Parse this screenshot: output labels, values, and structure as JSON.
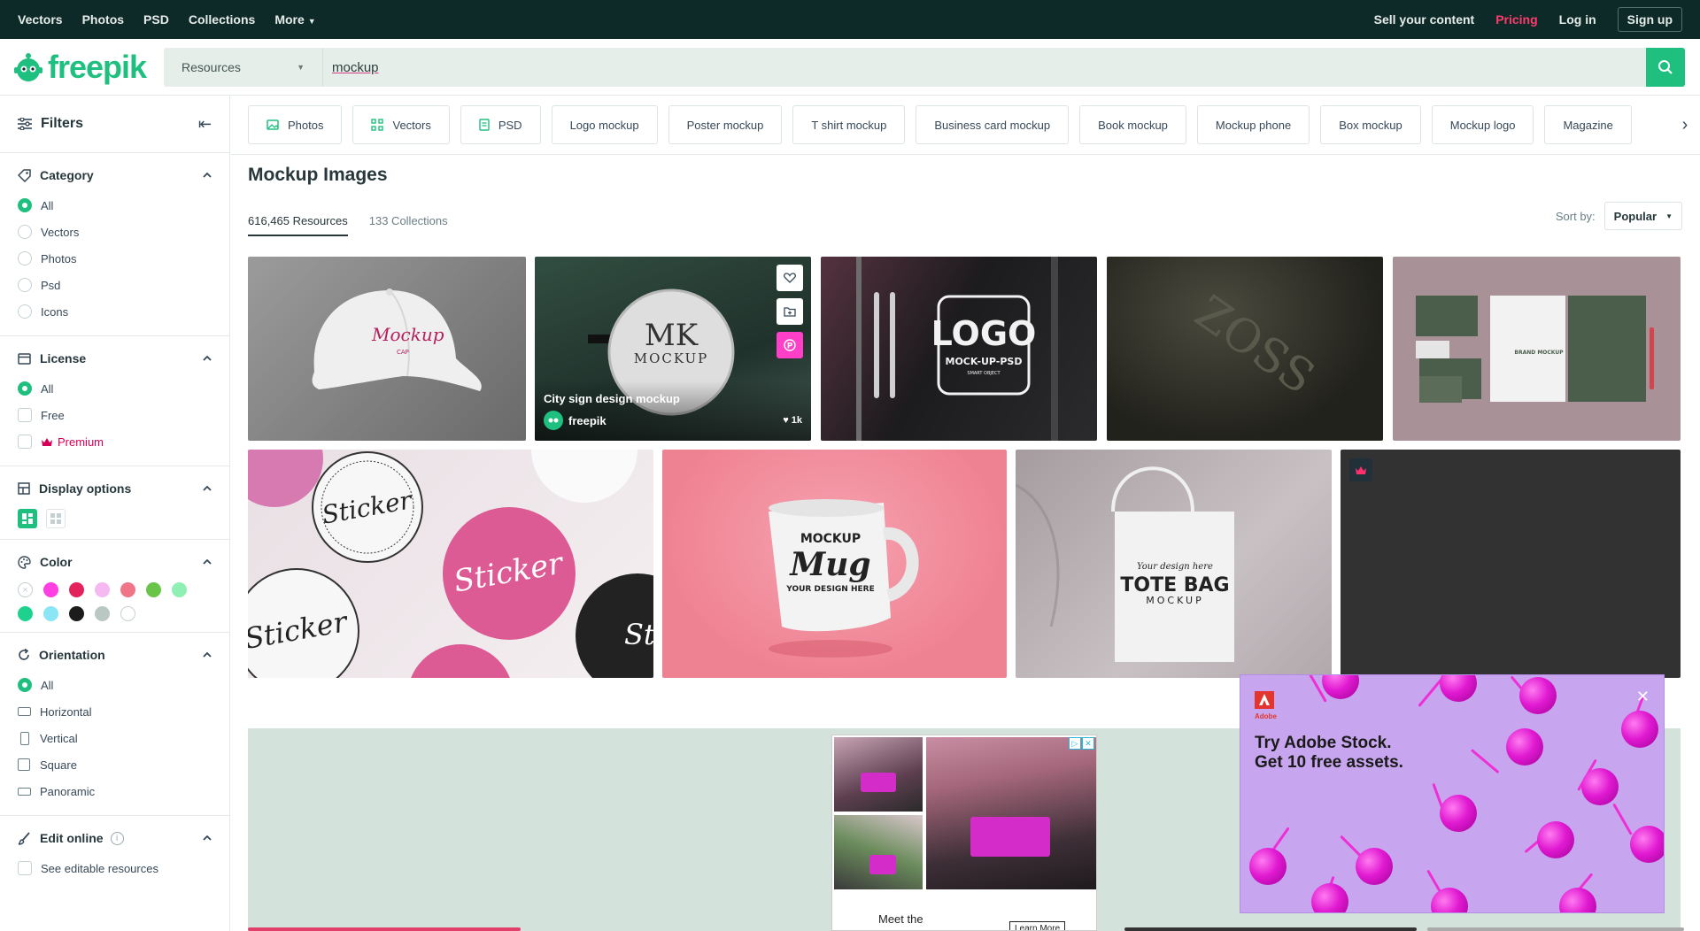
{
  "topbar": {
    "nav": [
      "Vectors",
      "Photos",
      "PSD",
      "Collections",
      "More"
    ],
    "sell": "Sell your content",
    "pricing": "Pricing",
    "login": "Log in",
    "signup": "Sign up"
  },
  "header": {
    "logo_text": "freepik",
    "search_type": "Resources",
    "search_value": "mockup"
  },
  "sidebar": {
    "title": "Filters",
    "category": {
      "title": "Category",
      "options": [
        "All",
        "Vectors",
        "Photos",
        "Psd",
        "Icons"
      ],
      "selected": "All"
    },
    "license": {
      "title": "License",
      "options": [
        "All",
        "Free",
        "Premium"
      ],
      "selected": "All"
    },
    "display": {
      "title": "Display options"
    },
    "color": {
      "title": "Color",
      "swatches": [
        "#ff3fe2",
        "#e3215a",
        "#f5b8f0",
        "#f07589",
        "#6ac44a",
        "#8ff0b4",
        "#1fd18f",
        "#8ae6f5",
        "#1c1c1c",
        "#b9c8c2",
        "#ffffff"
      ]
    },
    "orientation": {
      "title": "Orientation",
      "options": [
        "All",
        "Horizontal",
        "Vertical",
        "Square",
        "Panoramic"
      ],
      "selected": "All"
    },
    "edit_online": {
      "title": "Edit online",
      "option": "See editable resources"
    }
  },
  "main": {
    "chips": [
      "Photos",
      "Vectors",
      "PSD",
      "Logo mockup",
      "Poster mockup",
      "T shirt mockup",
      "Business card mockup",
      "Book mockup",
      "Mockup phone",
      "Box mockup",
      "Mockup logo",
      "Magazine"
    ],
    "title": "Mockup Images",
    "tabs": [
      "616,465 Resources",
      "133 Collections"
    ],
    "sort_label": "Sort by:",
    "sort_value": "Popular"
  },
  "cards": [
    {
      "name": "cap-mockup",
      "overlay_text": "Mockup",
      "sub": "CAP"
    },
    {
      "name": "city-sign-mockup",
      "caption": "City sign design mockup",
      "author": "freepik",
      "likes": "1k",
      "sign_top": "MK",
      "sign_bottom": "MOCKUP"
    },
    {
      "name": "logo-glass-mockup",
      "logo": "LOGO",
      "sub": "MOCK-UP-PSD",
      "small": "SMART OBJECT"
    },
    {
      "name": "fabric-emboss-mockup",
      "text": "ZOSS"
    },
    {
      "name": "brand-stationery-mockup",
      "text": "BRAND MOCKUP"
    },
    {
      "name": "sticker-mockup",
      "text": "Sticker"
    },
    {
      "name": "mug-mockup",
      "top": "MOCKUP",
      "main": "Mug",
      "bottom": "YOUR DESIGN HERE"
    },
    {
      "name": "tote-bag-mockup",
      "script": "Your design here",
      "main": "TOTE BAG",
      "sub": "MOCKUP"
    },
    {
      "name": "premium-dark-mockup"
    }
  ],
  "ads": {
    "center_text": "Meet the",
    "center_cta": "Learn More",
    "adobe_brand": "Adobe",
    "adobe_headline_1": "Try Adobe Stock.",
    "adobe_headline_2": "Get 10 free assets."
  }
}
